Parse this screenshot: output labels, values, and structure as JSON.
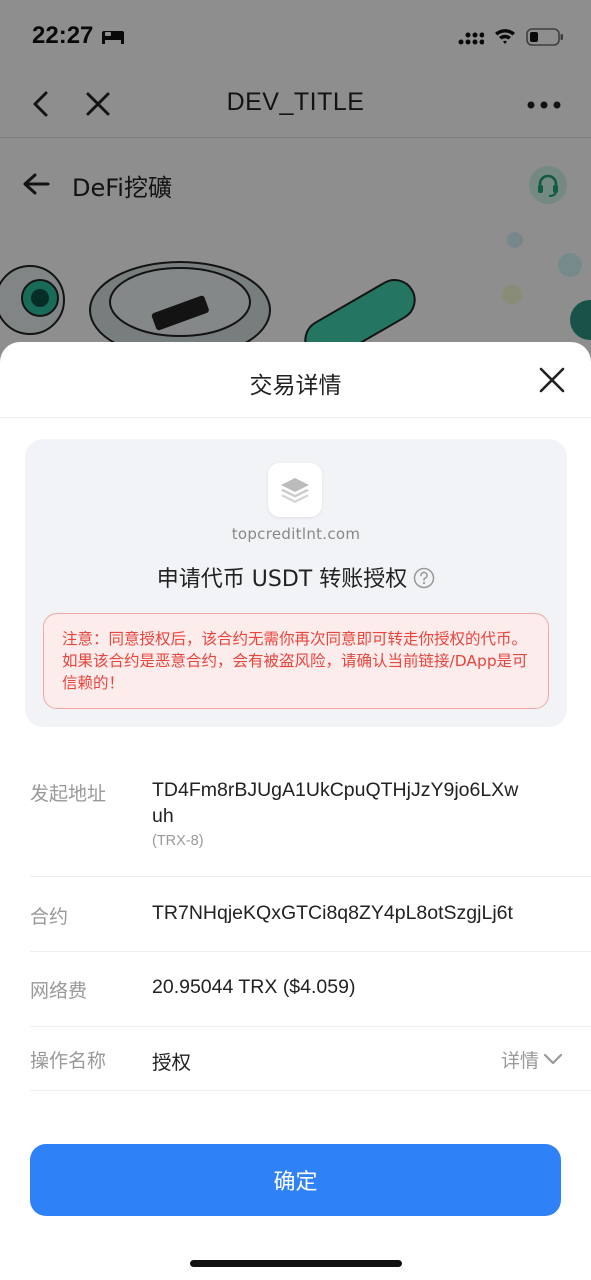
{
  "status_bar": {
    "time": "22:27"
  },
  "navbar": {
    "title": "DEV_TITLE"
  },
  "subheader": {
    "title": "DeFi挖礦"
  },
  "sheet": {
    "title": "交易详情",
    "dapp": {
      "domain": "topcreditlnt.com",
      "request_title": "申请代币 USDT 转账授权",
      "warning": "注意：同意授权后，该合约无需你再次同意即可转走你授权的代币。如果该合约是恶意合约，会有被盗风险，请确认当前链接/DApp是可信赖的！"
    },
    "rows": {
      "from": {
        "label": "发起地址",
        "value_line1": "TD4Fm8rBJUgA1UkCpuQTHjJzY9jo6LXw",
        "value_line2": "uh",
        "sub": "(TRX-8)"
      },
      "contract": {
        "label": "合约",
        "value": "TR7NHqjeKQxGTCi8q8ZY4pL8otSzgjLj6t"
      },
      "fee": {
        "label": "网络费",
        "value": "20.95044 TRX ($4.059)"
      },
      "operation": {
        "label": "操作名称",
        "value": "授权",
        "detail_label": "详情"
      }
    },
    "confirm_label": "确定"
  },
  "colors": {
    "primary": "#2f81f7",
    "warning_text": "#e8453c",
    "warning_bg": "#fdecec",
    "support_bg": "#c9ece0"
  }
}
